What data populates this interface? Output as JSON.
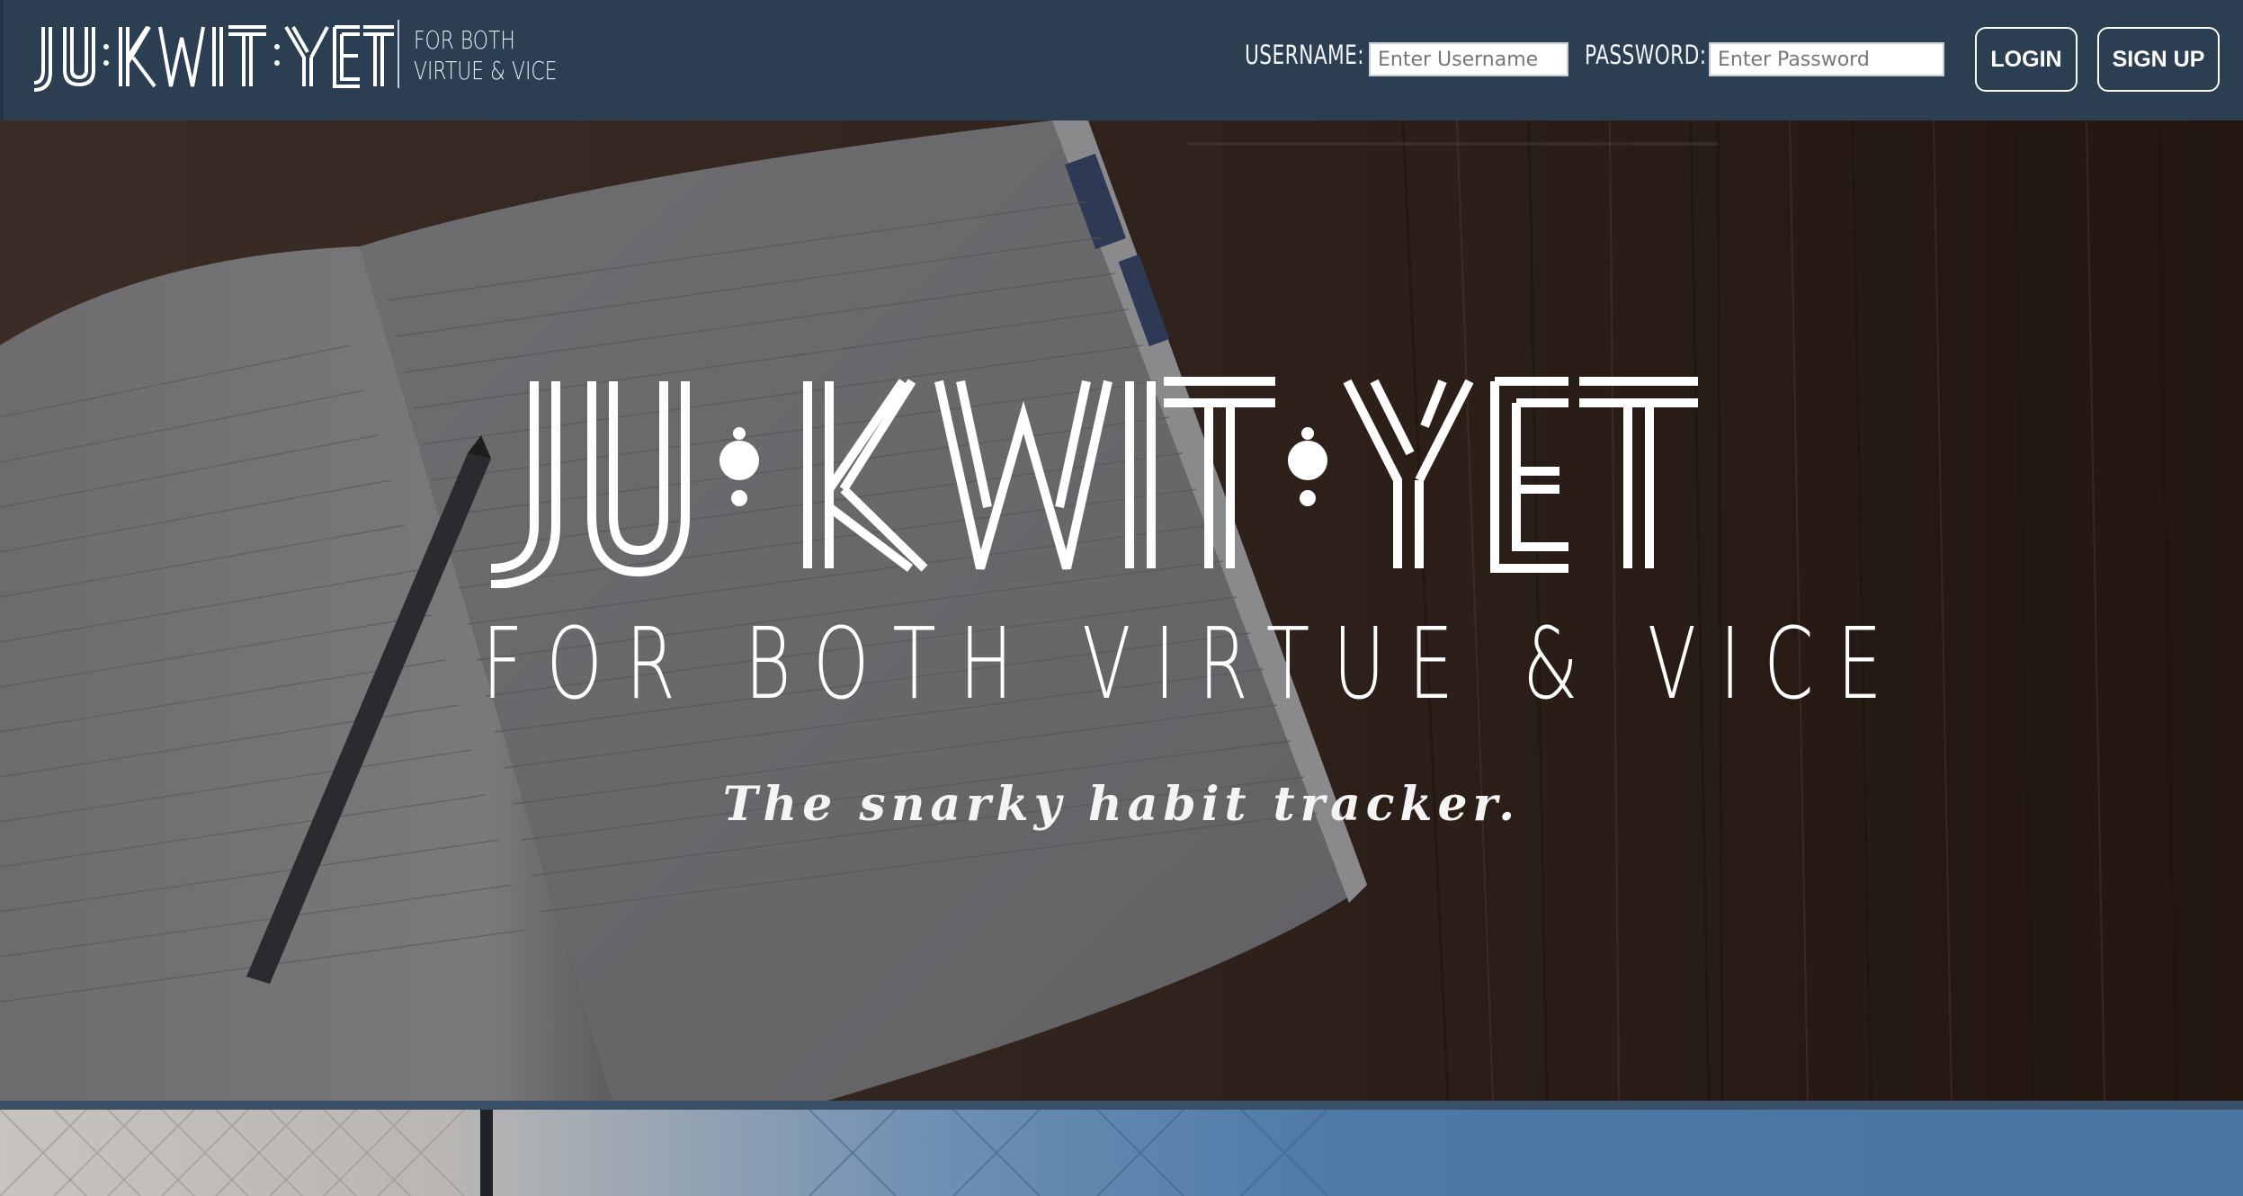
{
  "header": {
    "brand": "JU:KWIT:YET",
    "tagline_line1": "FOR BOTH",
    "tagline_line2": "VIRTUE & VICE",
    "username_label": "USERNAME:",
    "username_placeholder": "Enter Username",
    "password_label": "PASSWORD:",
    "password_placeholder": "Enter Password",
    "login_label": "LOGIN",
    "signup_label": "SIGN UP"
  },
  "hero": {
    "title": "JU:KWIT:YET",
    "subtitle": "FOR BOTH VIRTUE & VICE",
    "tagline": "The snarky habit tracker."
  },
  "colors": {
    "navbar": "#2c3e51",
    "accent_band": "#3a4f66",
    "text_on_dark": "#ffffff"
  }
}
